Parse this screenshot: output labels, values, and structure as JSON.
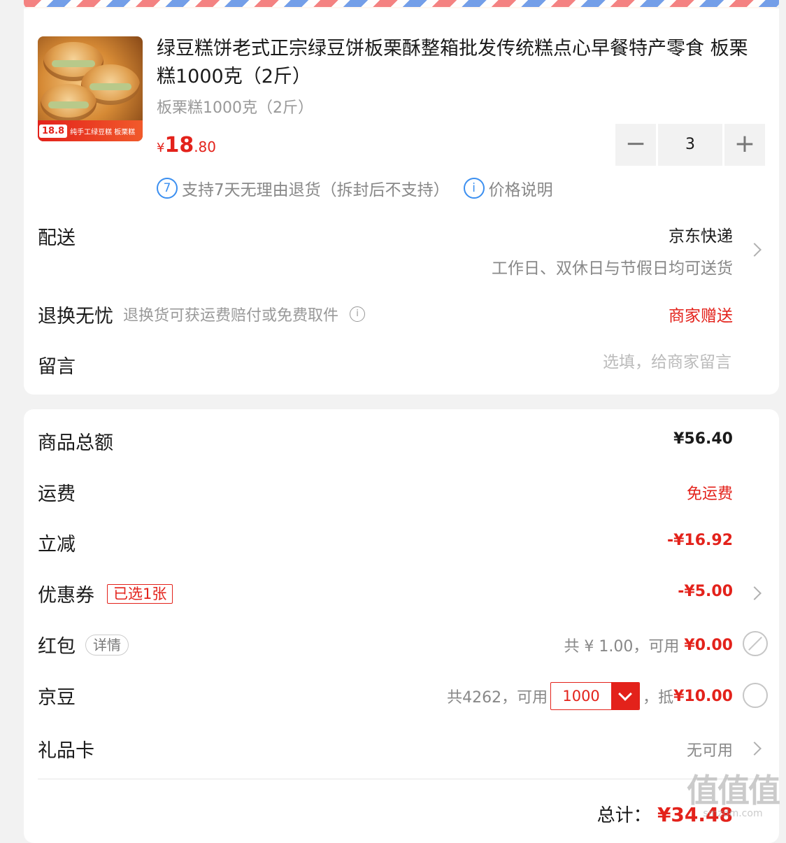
{
  "product": {
    "title": "绿豆糕饼老式正宗绿豆饼板栗酥整箱批发传统糕点心早餐特产零食 板栗糕1000克（2斤）",
    "spec": "板栗糕1000克（2斤）",
    "price_symbol": "¥",
    "price_integer": "18",
    "price_decimal": ".80",
    "thumbnail_price": "18.8",
    "thumbnail_tag": "纯手工绿豆糕 板栗糕",
    "quantity": {
      "minus": "−",
      "value": "3",
      "plus": "+"
    },
    "services": [
      {
        "icon_text": "7",
        "icon": "seven-day-return-icon",
        "label": "支持7天无理由退货（拆封后不支持）"
      },
      {
        "icon_text": "i",
        "icon": "info-icon",
        "label": "价格说明"
      }
    ]
  },
  "delivery": {
    "label": "配送",
    "method": "京东快递",
    "note": "工作日、双休日与节假日均可送货"
  },
  "returns": {
    "label": "退换无忧",
    "description": "退换货可获运费赔付或免费取件",
    "info_icon_text": "i",
    "value": "商家赠送"
  },
  "remark": {
    "label": "留言",
    "placeholder": "选填，给商家留言"
  },
  "summary": {
    "goods_total": {
      "label": "商品总额",
      "value": "¥56.40"
    },
    "shipping": {
      "label": "运费",
      "value": "免运费"
    },
    "instant_discount": {
      "label": "立减",
      "value": "-¥16.92"
    },
    "coupon": {
      "label": "优惠券",
      "badge": "已选1张",
      "value": "-¥5.00"
    },
    "red_packet": {
      "label": "红包",
      "detail": "详情",
      "total_text": "共 ¥ 1.00，可用 ",
      "available": "¥0.00"
    },
    "jd_beans": {
      "label": "京豆",
      "total_text": "共4262，可用",
      "selected": "1000",
      "offset_prefix": "，抵",
      "offset_amount": "¥10.00"
    },
    "gift_card": {
      "label": "礼品卡",
      "value": "无可用"
    },
    "total": {
      "label": "总计：",
      "value": "¥34.48"
    }
  },
  "colors": {
    "accent_red": "#e3221b",
    "info_blue": "#3b8ff0",
    "muted_gray": "#888888"
  },
  "watermark": {
    "logo": "值值值",
    "url": "smzdm.com"
  }
}
